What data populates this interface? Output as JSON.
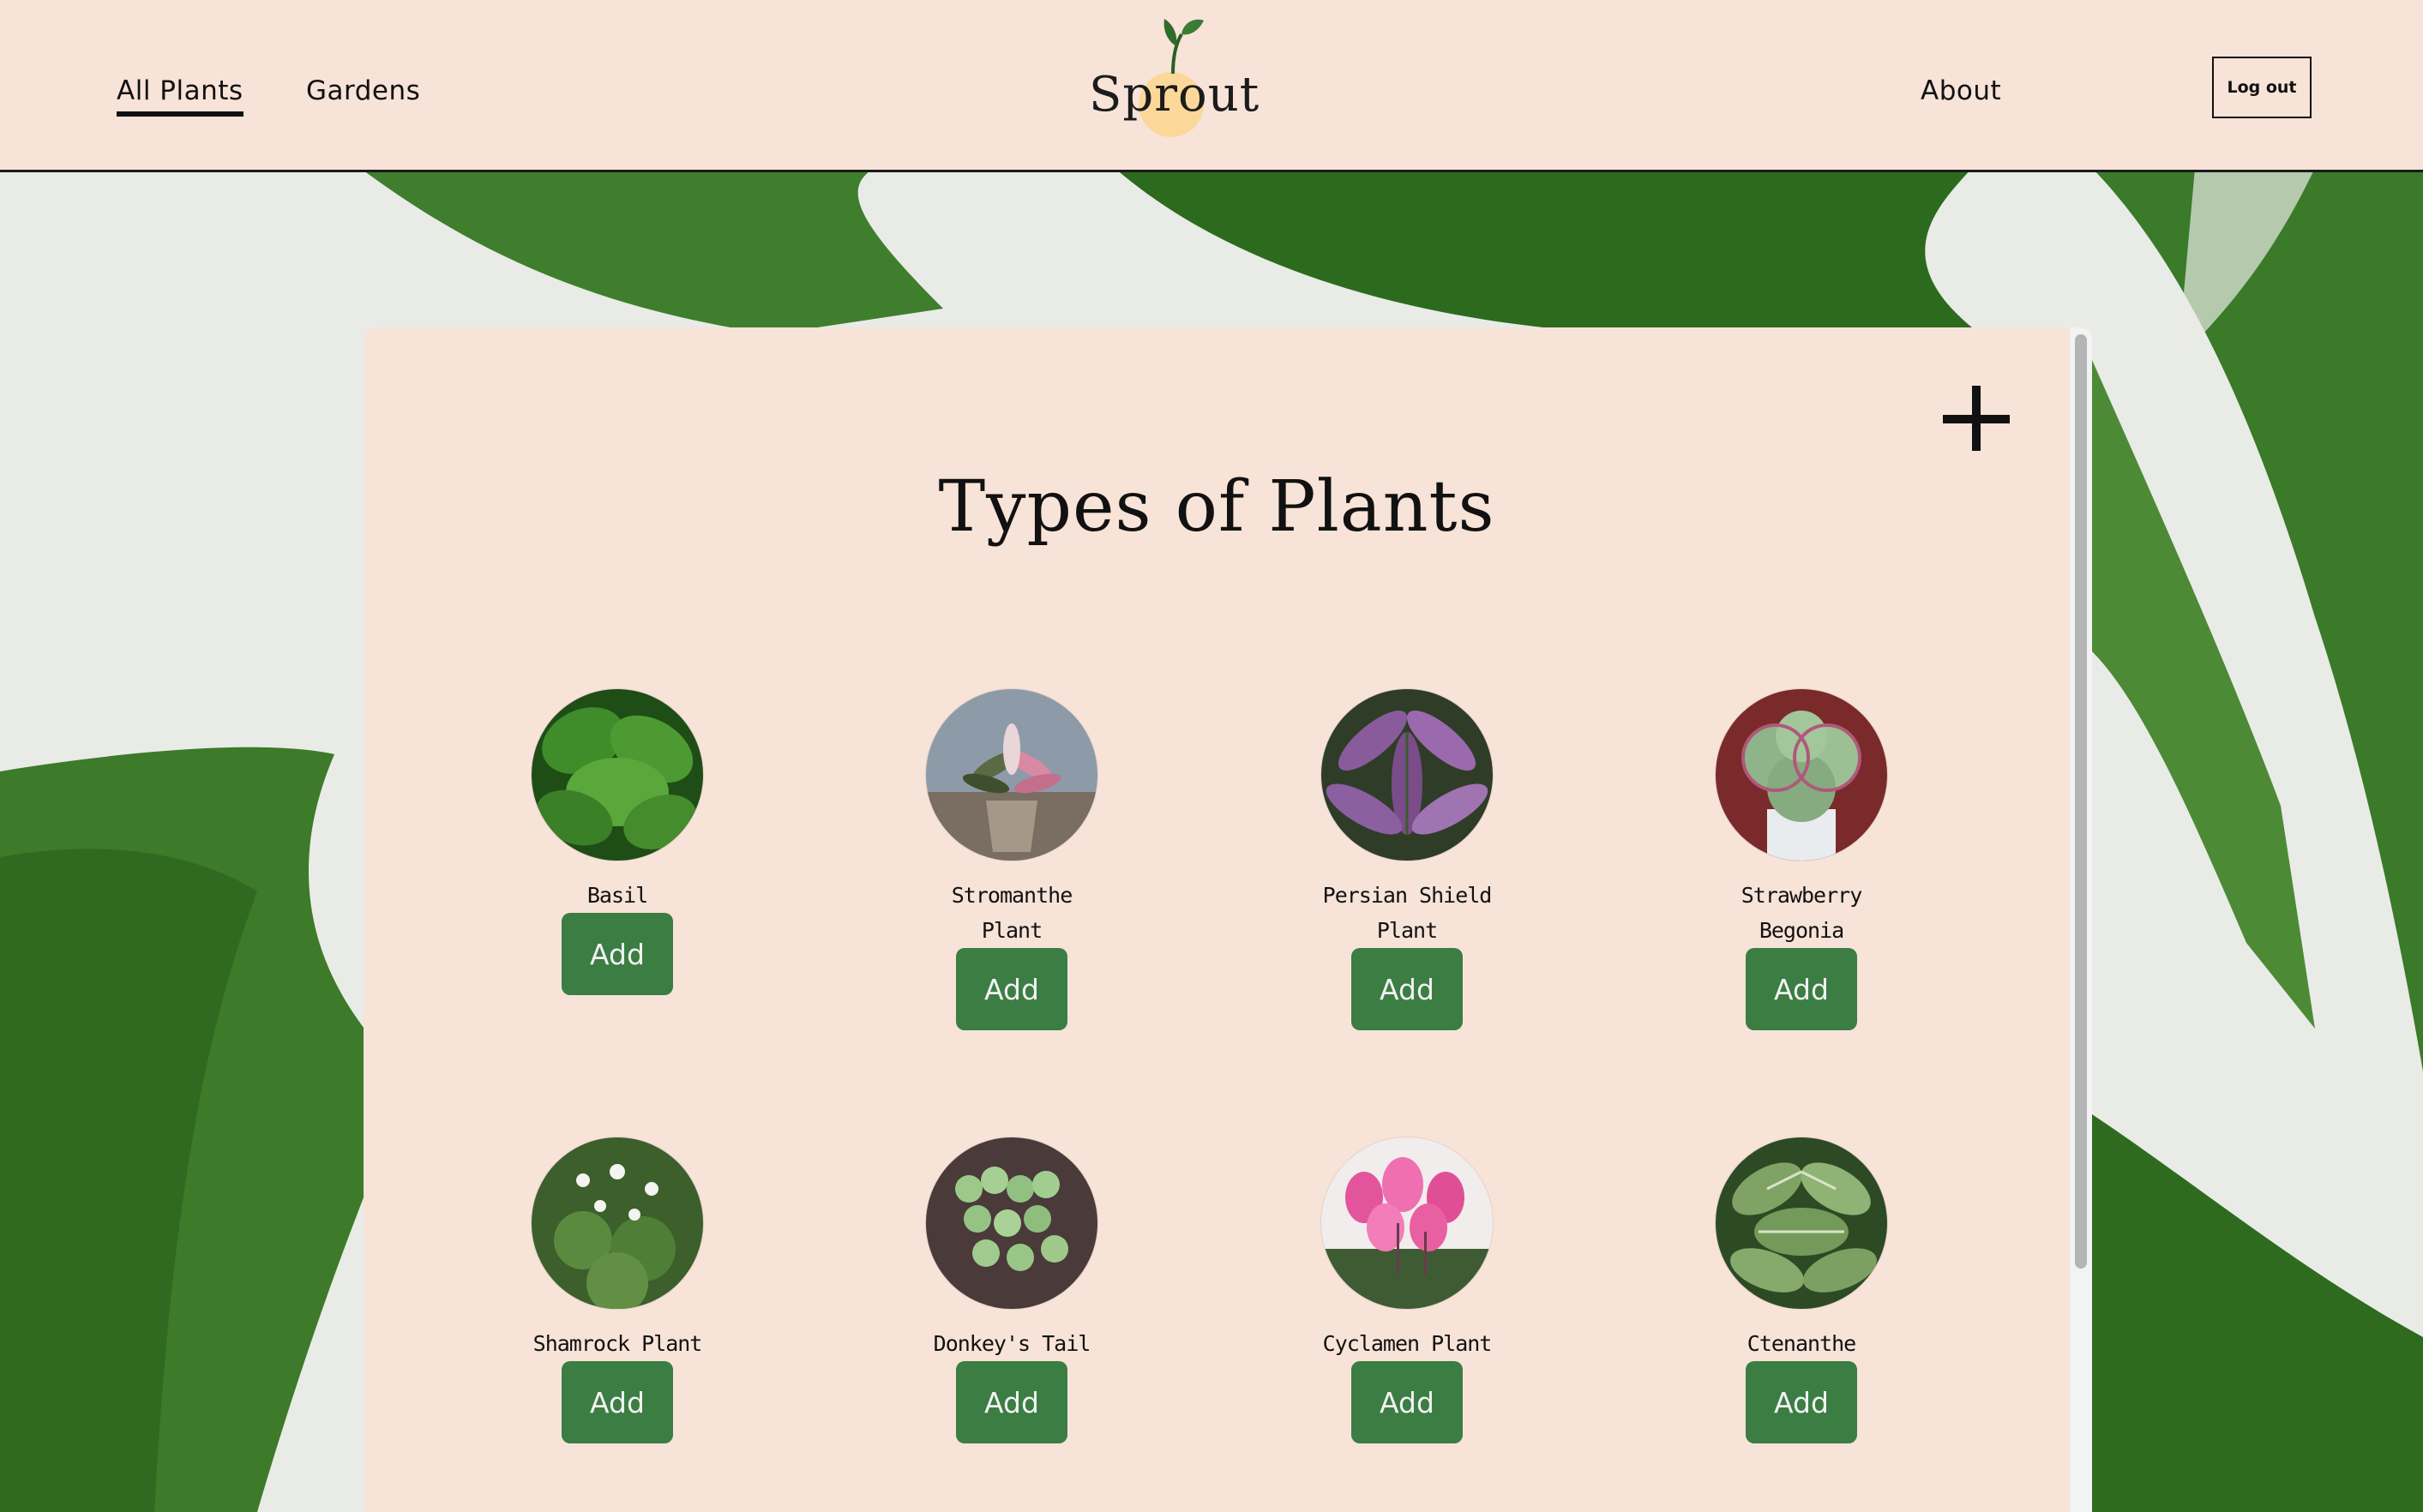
{
  "nav": {
    "links": [
      {
        "label": "All Plants",
        "active": true
      },
      {
        "label": "Gardens",
        "active": false
      }
    ],
    "about_label": "About",
    "logout_label": "Log out"
  },
  "logo": {
    "text": "Sprout"
  },
  "main": {
    "title": "Types of Plants",
    "add_icon": "plus-icon",
    "plants": [
      {
        "name": "Basil",
        "button": "Add",
        "image": "basil-photo"
      },
      {
        "name": "Stromanthe Plant",
        "button": "Add",
        "image": "stromanthe-photo"
      },
      {
        "name": "Persian Shield Plant",
        "button": "Add",
        "image": "persian-shield-photo"
      },
      {
        "name": "Strawberry Begonia",
        "button": "Add",
        "image": "strawberry-begonia-photo"
      },
      {
        "name": "Shamrock Plant",
        "button": "Add",
        "image": "shamrock-photo"
      },
      {
        "name": "Donkey's Tail",
        "button": "Add",
        "image": "donkeys-tail-photo"
      },
      {
        "name": "Cyclamen Plant",
        "button": "Add",
        "image": "cyclamen-photo"
      },
      {
        "name": "Ctenanthe",
        "button": "Add",
        "image": "ctenanthe-photo"
      }
    ]
  },
  "colors": {
    "navbar": "#f7e3d8",
    "card": "#f7e3d8",
    "button": "#3b7d43",
    "text": "#111111"
  }
}
